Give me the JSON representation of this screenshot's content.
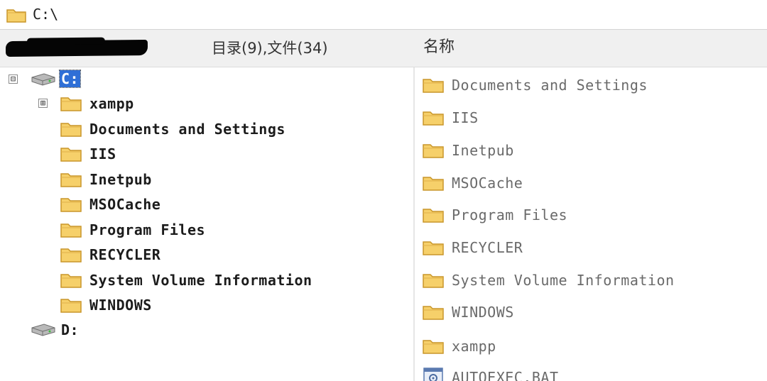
{
  "address_bar": {
    "path": "C:\\",
    "icon": "folder-icon"
  },
  "header": {
    "count_label": "目录(9),文件(34)",
    "name_column": "名称"
  },
  "tree": {
    "drive_c": {
      "label": "C:",
      "expander": "⊟",
      "icon": "drive-icon",
      "selected": true
    },
    "xampp": {
      "label": "xampp",
      "expander": "⊞"
    },
    "children": [
      {
        "label": "Documents and Settings"
      },
      {
        "label": "IIS"
      },
      {
        "label": "Inetpub"
      },
      {
        "label": "MSOCache"
      },
      {
        "label": "Program Files"
      },
      {
        "label": "RECYCLER"
      },
      {
        "label": "System Volume Information"
      },
      {
        "label": "WINDOWS"
      }
    ],
    "drive_d": {
      "label": "D:",
      "icon": "drive-icon"
    }
  },
  "list": {
    "items": [
      {
        "label": "Documents and Settings",
        "icon": "folder-icon"
      },
      {
        "label": "IIS",
        "icon": "folder-icon"
      },
      {
        "label": "Inetpub",
        "icon": "folder-icon"
      },
      {
        "label": "MSOCache",
        "icon": "folder-icon"
      },
      {
        "label": "Program Files",
        "icon": "folder-icon"
      },
      {
        "label": "RECYCLER",
        "icon": "folder-icon"
      },
      {
        "label": "System Volume Information",
        "icon": "folder-icon"
      },
      {
        "label": "WINDOWS",
        "icon": "folder-icon"
      },
      {
        "label": "xampp",
        "icon": "folder-icon"
      },
      {
        "label": "AUTOEXEC.BAT",
        "icon": "batch-file-icon"
      }
    ]
  },
  "colors": {
    "folder_fill": "#f6d06a",
    "folder_stroke": "#c9962a",
    "selection": "#2f6fd6"
  }
}
